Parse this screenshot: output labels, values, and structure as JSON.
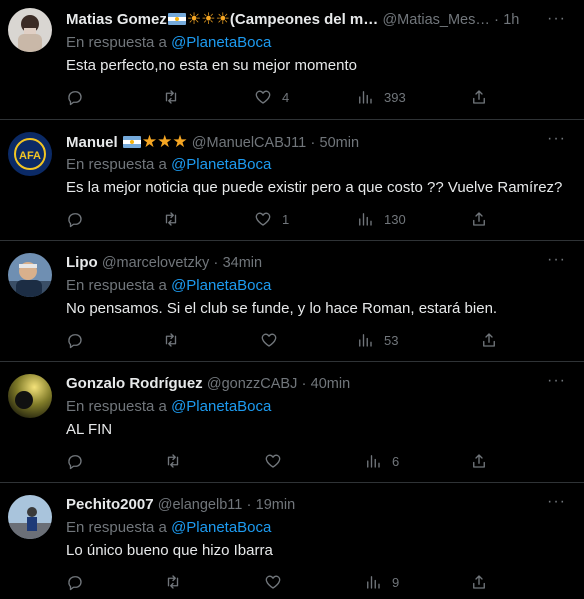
{
  "reply_prefix": "En respuesta a",
  "tweets": [
    {
      "name": "Matias Gomez",
      "name_suffix": "(Campeones del m…",
      "handle": "@Matias_Mes…",
      "time": "1h",
      "reply_to": "@PlanetaBoca",
      "text": "Esta perfecto,no esta en su mejor momento",
      "likes": "4",
      "views": "393",
      "replies": "",
      "retweets": ""
    },
    {
      "name": "Manuel",
      "handle": "@ManuelCABJ11",
      "time": "50min",
      "reply_to": "@PlanetaBoca",
      "text": "Es la mejor noticia que puede existir pero a que costo ?? Vuelve Ramírez?",
      "likes": "1",
      "views": "130",
      "replies": "",
      "retweets": ""
    },
    {
      "name": "Lipo",
      "handle": "@marcelovetzky",
      "time": "34min",
      "reply_to": "@PlanetaBoca",
      "text": "No pensamos. Si el club se funde, y lo hace Roman, estará bien.",
      "likes": "",
      "views": "53",
      "replies": "",
      "retweets": ""
    },
    {
      "name": "Gonzalo Rodríguez",
      "handle": "@gonzzCABJ",
      "time": "40min",
      "reply_to": "@PlanetaBoca",
      "text": "AL FIN",
      "likes": "",
      "views": "6",
      "replies": "",
      "retweets": ""
    },
    {
      "name": "Pechito2007",
      "handle": "@elangelb11",
      "time": "19min",
      "reply_to": "@PlanetaBoca",
      "text": "Lo único bueno que hizo Ibarra",
      "likes": "",
      "views": "9",
      "replies": "",
      "retweets": ""
    }
  ],
  "icons": {
    "reply": "reply-icon",
    "retweet": "retweet-icon",
    "like": "heart-icon",
    "views": "views-chart-icon",
    "share": "share-icon",
    "more": "more-icon"
  },
  "colors": {
    "background": "#000000",
    "text": "#e7e9ea",
    "muted": "#71767b",
    "link": "#1d9bf0",
    "divider": "#2f3336"
  }
}
